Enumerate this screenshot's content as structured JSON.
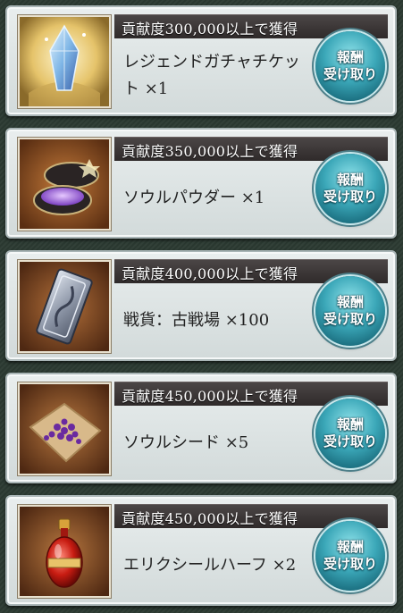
{
  "rewards": [
    {
      "condition": "貢献度300,000以上で獲得",
      "item_line1": "レジェンドガチャチケッ",
      "item_line2": "ト ×1",
      "icon": "legend-gacha-ticket-crystal-icon"
    },
    {
      "condition": "貢献度350,000以上で獲得",
      "item_line1": "ソウルパウダー ×1",
      "item_line2": "",
      "icon": "soul-powder-box-icon"
    },
    {
      "condition": "貢献度400,000以上で獲得",
      "item_line1": "戦貨：古戦場 ×100",
      "item_line2": "",
      "icon": "battle-medal-token-icon"
    },
    {
      "condition": "貢献度450,000以上で獲得",
      "item_line1": "ソウルシード ×5",
      "item_line2": "",
      "icon": "soul-seed-pile-icon"
    },
    {
      "condition": "貢献度450,000以上で獲得",
      "item_line1": "エリクシールハーフ ×2",
      "item_line2": "",
      "icon": "elixir-half-bottle-icon"
    }
  ],
  "button": {
    "line1": "報酬",
    "line2": "受け取り"
  },
  "colors": {
    "header_bg": "#2f2a2a",
    "card_bg": "#e3e9e9",
    "button": "#3ba7b8",
    "page_bg": "#2b3a32"
  }
}
